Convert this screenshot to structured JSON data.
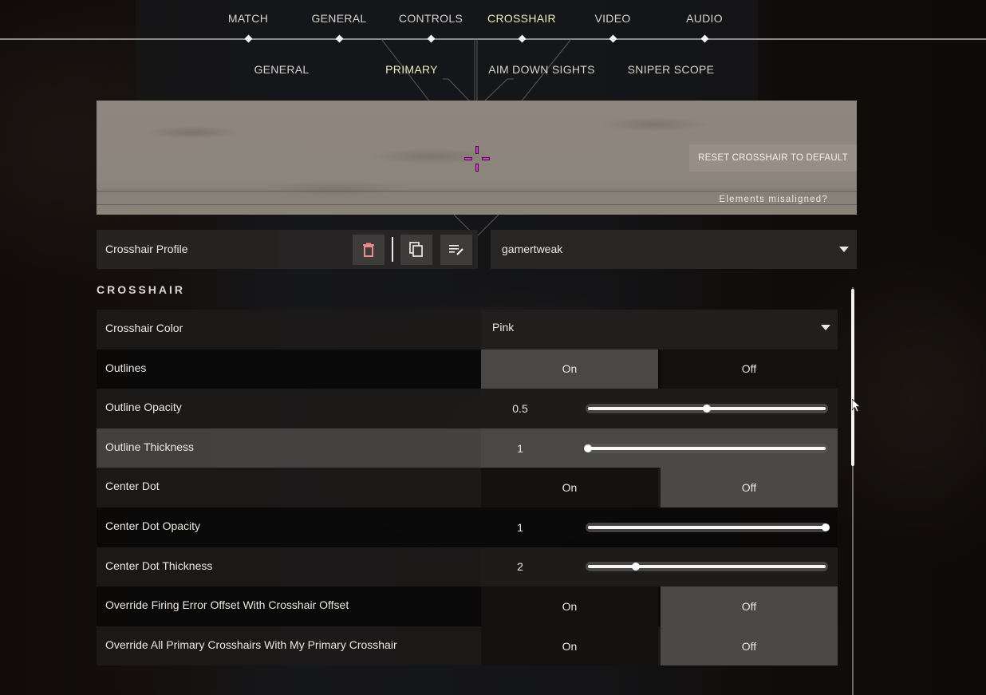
{
  "top_nav": {
    "tabs": [
      {
        "label": "MATCH",
        "active": false
      },
      {
        "label": "GENERAL",
        "active": false
      },
      {
        "label": "CONTROLS",
        "active": false
      },
      {
        "label": "CROSSHAIR",
        "active": true
      },
      {
        "label": "VIDEO",
        "active": false
      },
      {
        "label": "AUDIO",
        "active": false
      }
    ]
  },
  "sub_nav": {
    "tabs": [
      {
        "label": "GENERAL",
        "active": false
      },
      {
        "label": "PRIMARY",
        "active": true
      },
      {
        "label": "AIM DOWN SIGHTS",
        "active": false
      },
      {
        "label": "SNIPER SCOPE",
        "active": false
      }
    ]
  },
  "preview": {
    "reset_label": "RESET CROSSHAIR TO DEFAULT",
    "misaligned_label": "Elements misaligned?",
    "crosshair_color": "#e52ee0"
  },
  "profile": {
    "label": "Crosshair Profile",
    "icons": [
      "trash-icon",
      "copy-icon",
      "rename-icon"
    ],
    "selected": "gamertweak"
  },
  "section": {
    "title": "CROSSHAIR"
  },
  "settings": [
    {
      "label": "Crosshair Color",
      "type": "dropdown",
      "value": "Pink"
    },
    {
      "label": "Outlines",
      "type": "toggle",
      "on_label": "On",
      "off_label": "Off",
      "value": "On"
    },
    {
      "label": "Outline Opacity",
      "type": "slider",
      "value": "0.5",
      "fraction": 0.5
    },
    {
      "label": "Outline Thickness",
      "type": "slider",
      "value": "1",
      "fraction": 0.0
    },
    {
      "label": "Center Dot",
      "type": "toggle",
      "on_label": "On",
      "off_label": "Off",
      "value": "Off"
    },
    {
      "label": "Center Dot Opacity",
      "type": "slider",
      "value": "1",
      "fraction": 1.0
    },
    {
      "label": "Center Dot Thickness",
      "type": "slider",
      "value": "2",
      "fraction": 0.2
    },
    {
      "label": "Override Firing Error Offset With Crosshair Offset",
      "type": "toggle",
      "on_label": "On",
      "off_label": "Off",
      "value": "Off"
    },
    {
      "label": "Override All Primary Crosshairs With My Primary Crosshair",
      "type": "toggle",
      "on_label": "On",
      "off_label": "Off",
      "value": "Off"
    }
  ],
  "scroll": {
    "position_fraction": 0.0
  }
}
